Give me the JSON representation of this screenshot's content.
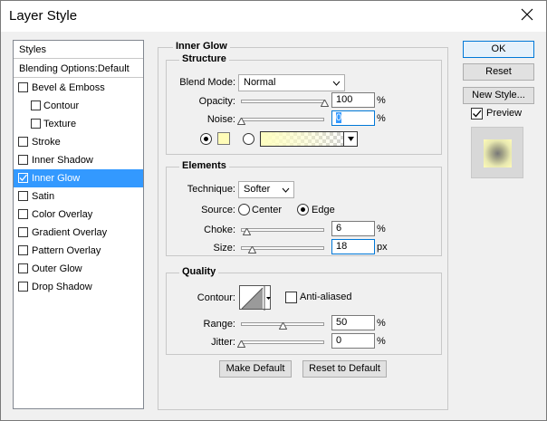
{
  "window": {
    "title": "Layer Style"
  },
  "styles_list": {
    "header": "Styles",
    "blending": "Blending Options:Default",
    "items": [
      {
        "label": "Bevel & Emboss",
        "checked": false,
        "indent": false
      },
      {
        "label": "Contour",
        "checked": false,
        "indent": true
      },
      {
        "label": "Texture",
        "checked": false,
        "indent": true
      },
      {
        "label": "Stroke",
        "checked": false,
        "indent": false
      },
      {
        "label": "Inner Shadow",
        "checked": false,
        "indent": false
      },
      {
        "label": "Inner Glow",
        "checked": true,
        "indent": false,
        "selected": true
      },
      {
        "label": "Satin",
        "checked": false,
        "indent": false
      },
      {
        "label": "Color Overlay",
        "checked": false,
        "indent": false
      },
      {
        "label": "Gradient Overlay",
        "checked": false,
        "indent": false
      },
      {
        "label": "Pattern Overlay",
        "checked": false,
        "indent": false
      },
      {
        "label": "Outer Glow",
        "checked": false,
        "indent": false
      },
      {
        "label": "Drop Shadow",
        "checked": false,
        "indent": false
      }
    ]
  },
  "inner_glow": {
    "title": "Inner Glow",
    "structure": {
      "title": "Structure",
      "blend_mode_label": "Blend Mode:",
      "blend_mode_value": "Normal",
      "opacity_label": "Opacity:",
      "opacity_value": "100",
      "opacity_unit": "%",
      "noise_label": "Noise:",
      "noise_value": "0",
      "noise_unit": "%",
      "color_swatch": "#fffcb8"
    },
    "elements": {
      "title": "Elements",
      "technique_label": "Technique:",
      "technique_value": "Softer",
      "source_label": "Source:",
      "source_center": "Center",
      "source_edge": "Edge",
      "choke_label": "Choke:",
      "choke_value": "6",
      "choke_unit": "%",
      "size_label": "Size:",
      "size_value": "18",
      "size_unit": "px"
    },
    "quality": {
      "title": "Quality",
      "contour_label": "Contour:",
      "anti_aliased_label": "Anti-aliased",
      "range_label": "Range:",
      "range_value": "50",
      "range_unit": "%",
      "jitter_label": "Jitter:",
      "jitter_value": "0",
      "jitter_unit": "%"
    },
    "make_default": "Make Default",
    "reset_to_default": "Reset to Default"
  },
  "buttons": {
    "ok": "OK",
    "reset": "Reset",
    "new_style": "New Style...",
    "preview": "Preview"
  },
  "colors": {
    "selection": "#3399ff",
    "glow_color": "#fffcb8"
  }
}
